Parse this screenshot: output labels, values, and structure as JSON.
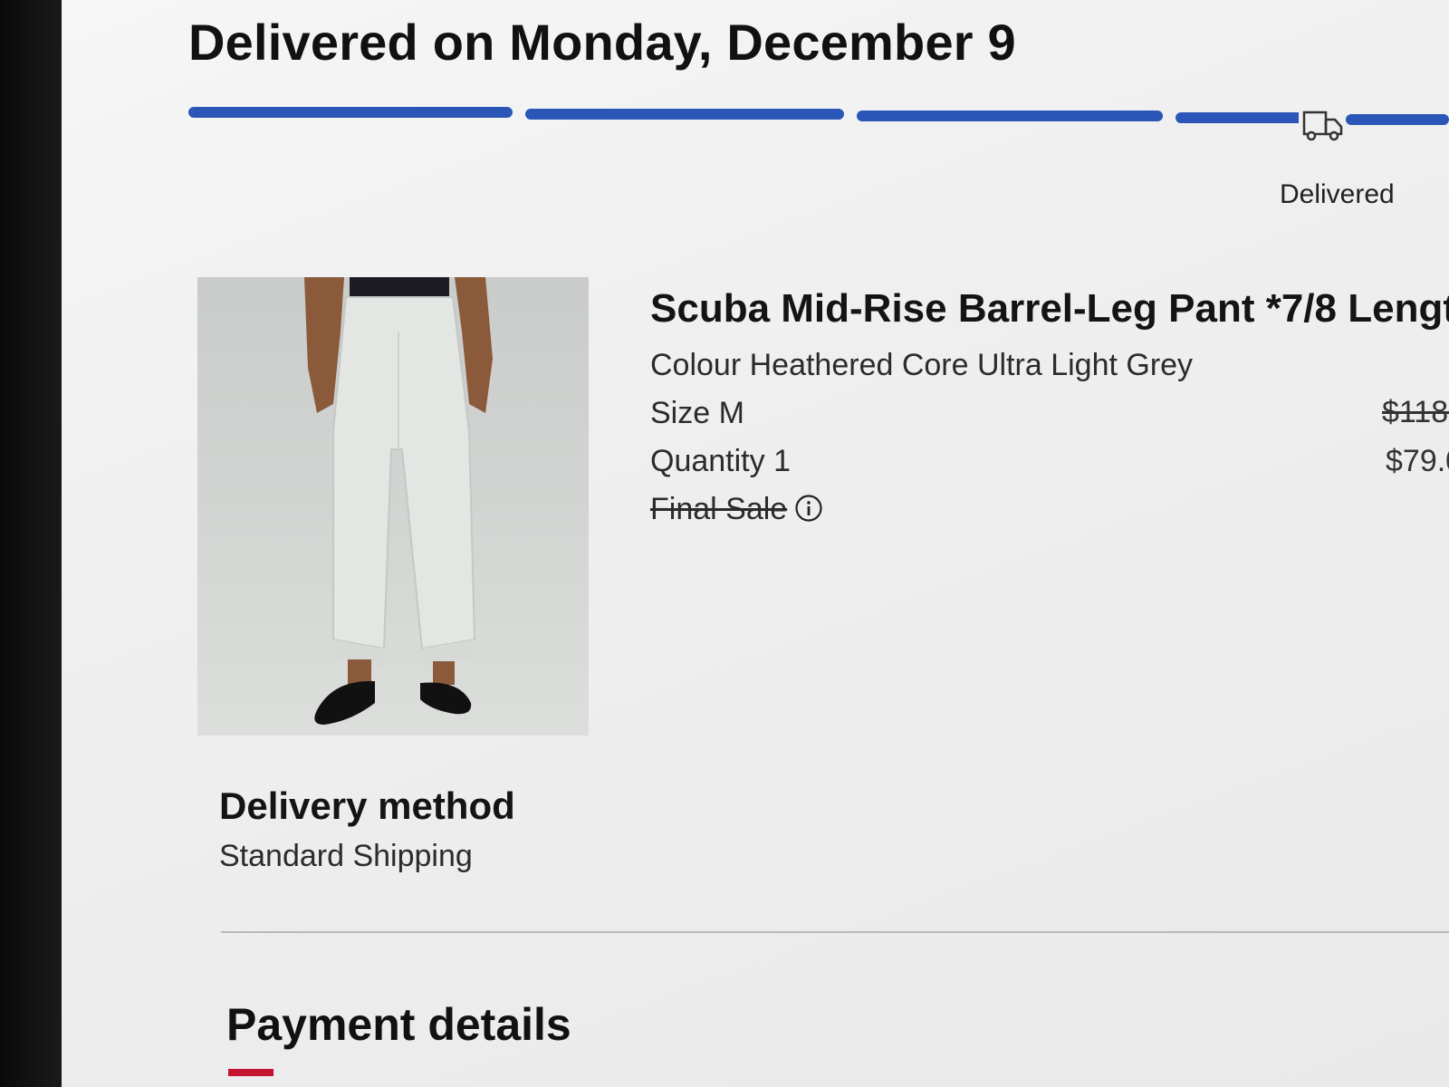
{
  "colors": {
    "progress": "#2a56b8",
    "accent": "#c4122f"
  },
  "order": {
    "title": "Delivered on Monday, December 9",
    "tracker": {
      "current_stage": "Delivered",
      "segments_complete": 5,
      "icon": "truck-icon"
    }
  },
  "item": {
    "name": "Scuba Mid-Rise Barrel-Leg Pant *7/8 Lengt",
    "colour": "Colour Heathered Core Ultra Light Grey",
    "size": "Size M",
    "quantity": "Quantity 1",
    "final_sale": "Final Sale",
    "price_original": "$118.",
    "price_sale": "$79.0"
  },
  "delivery": {
    "heading": "Delivery method",
    "value": "Standard Shipping"
  },
  "payment": {
    "heading": "Payment details"
  }
}
